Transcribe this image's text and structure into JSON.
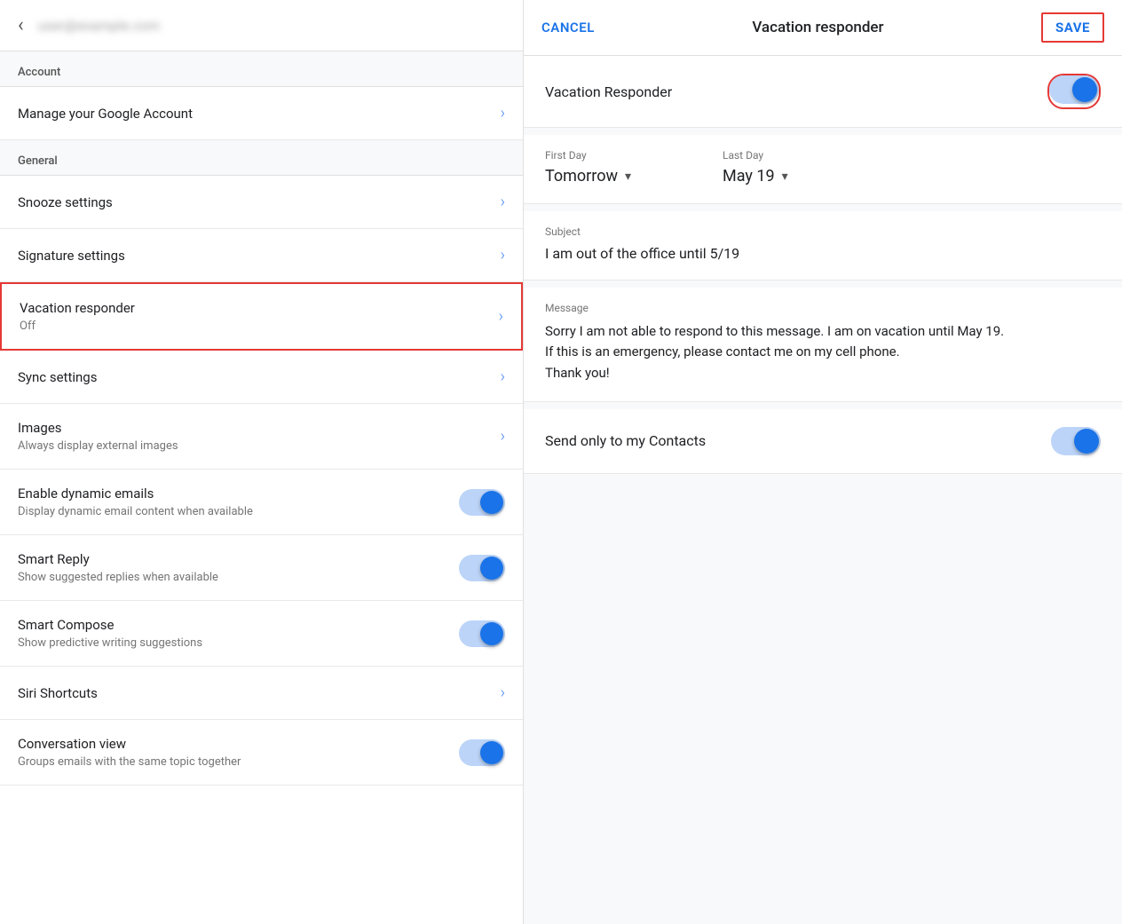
{
  "left": {
    "back_icon": "‹",
    "account_email": "user@example.com",
    "section_account": "Account",
    "manage_account": "Manage your Google Account",
    "section_general": "General",
    "snooze_settings": "Snooze settings",
    "signature_settings": "Signature settings",
    "vacation_responder": "Vacation responder",
    "vacation_status": "Off",
    "sync_settings": "Sync settings",
    "images_title": "Images",
    "images_subtitle": "Always display external images",
    "dynamic_email_title": "Enable dynamic emails",
    "dynamic_email_subtitle": "Display dynamic email content when available",
    "smart_reply_title": "Smart Reply",
    "smart_reply_subtitle": "Show suggested replies when available",
    "smart_compose_title": "Smart Compose",
    "smart_compose_subtitle": "Show predictive writing suggestions",
    "siri_shortcuts": "Siri Shortcuts",
    "conversation_view_title": "Conversation view",
    "conversation_view_subtitle": "Groups emails with the same topic together"
  },
  "right": {
    "cancel_label": "CANCEL",
    "title": "Vacation responder",
    "save_label": "SAVE",
    "vac_responder_label": "Vacation Responder",
    "first_day_label": "First Day",
    "first_day_value": "Tomorrow",
    "last_day_label": "Last Day",
    "last_day_value": "May 19",
    "subject_label": "Subject",
    "subject_value": "I am out of the office until 5/19",
    "message_label": "Message",
    "message_value": "Sorry I am not able to respond to this message. I am on vacation until May 19.\nIf this is an emergency, please contact me on my cell phone.\nThank you!",
    "contacts_label": "Send only to my Contacts"
  }
}
